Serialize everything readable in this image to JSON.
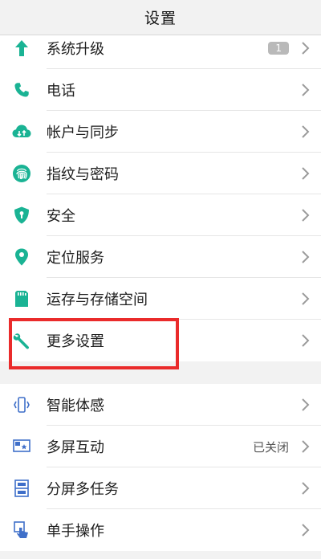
{
  "header": {
    "title": "设置"
  },
  "section1": [
    {
      "label": "系统升级",
      "icon": "arrow-up-icon",
      "badge": "1"
    },
    {
      "label": "电话",
      "icon": "phone-icon"
    },
    {
      "label": "帐户与同步",
      "icon": "cloud-sync-icon"
    },
    {
      "label": "指纹与密码",
      "icon": "fingerprint-icon"
    },
    {
      "label": "安全",
      "icon": "shield-icon"
    },
    {
      "label": "定位服务",
      "icon": "location-pin-icon"
    },
    {
      "label": "运存与存储空间",
      "icon": "sd-card-icon"
    },
    {
      "label": "更多设置",
      "icon": "wrench-icon"
    }
  ],
  "section2": [
    {
      "label": "智能体感",
      "icon": "motion-phone-icon"
    },
    {
      "label": "多屏互动",
      "icon": "screen-cast-icon",
      "value": "已关闭"
    },
    {
      "label": "分屏多任务",
      "icon": "split-screen-icon"
    },
    {
      "label": "单手操作",
      "icon": "one-hand-icon"
    }
  ],
  "colors": {
    "accent": "#1ab394",
    "blue_icon": "#3f6fc9",
    "highlight": "#ea2b2b"
  }
}
